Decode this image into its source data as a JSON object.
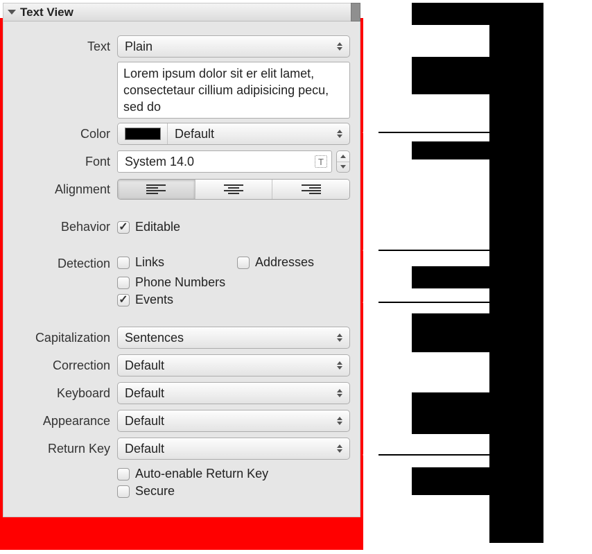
{
  "header": {
    "title": "Text View"
  },
  "text_row": {
    "label": "Text",
    "popup_value": "Plain",
    "content": "Lorem ipsum dolor sit er elit lamet, consectetaur cillium adipisicing pecu, sed do"
  },
  "color_row": {
    "label": "Color",
    "swatch_hex": "#000000",
    "popup_value": "Default"
  },
  "font_row": {
    "label": "Font",
    "value": "System 14.0"
  },
  "alignment_row": {
    "label": "Alignment",
    "selected": "left"
  },
  "behavior_row": {
    "label": "Behavior",
    "editable_label": "Editable",
    "editable_checked": true
  },
  "detection_row": {
    "label": "Detection",
    "items": {
      "links": {
        "label": "Links",
        "checked": false
      },
      "addresses": {
        "label": "Addresses",
        "checked": false
      },
      "phone_numbers": {
        "label": "Phone Numbers",
        "checked": false
      },
      "events": {
        "label": "Events",
        "checked": true
      }
    }
  },
  "capitalization_row": {
    "label": "Capitalization",
    "value": "Sentences"
  },
  "correction_row": {
    "label": "Correction",
    "value": "Default"
  },
  "keyboard_row": {
    "label": "Keyboard",
    "value": "Default"
  },
  "appearance_row": {
    "label": "Appearance",
    "value": "Default"
  },
  "return_key_row": {
    "label": "Return Key",
    "value": "Default"
  },
  "return_key_opts": {
    "auto_enable": {
      "label": "Auto-enable Return Key",
      "checked": false
    },
    "secure": {
      "label": "Secure",
      "checked": false
    }
  }
}
